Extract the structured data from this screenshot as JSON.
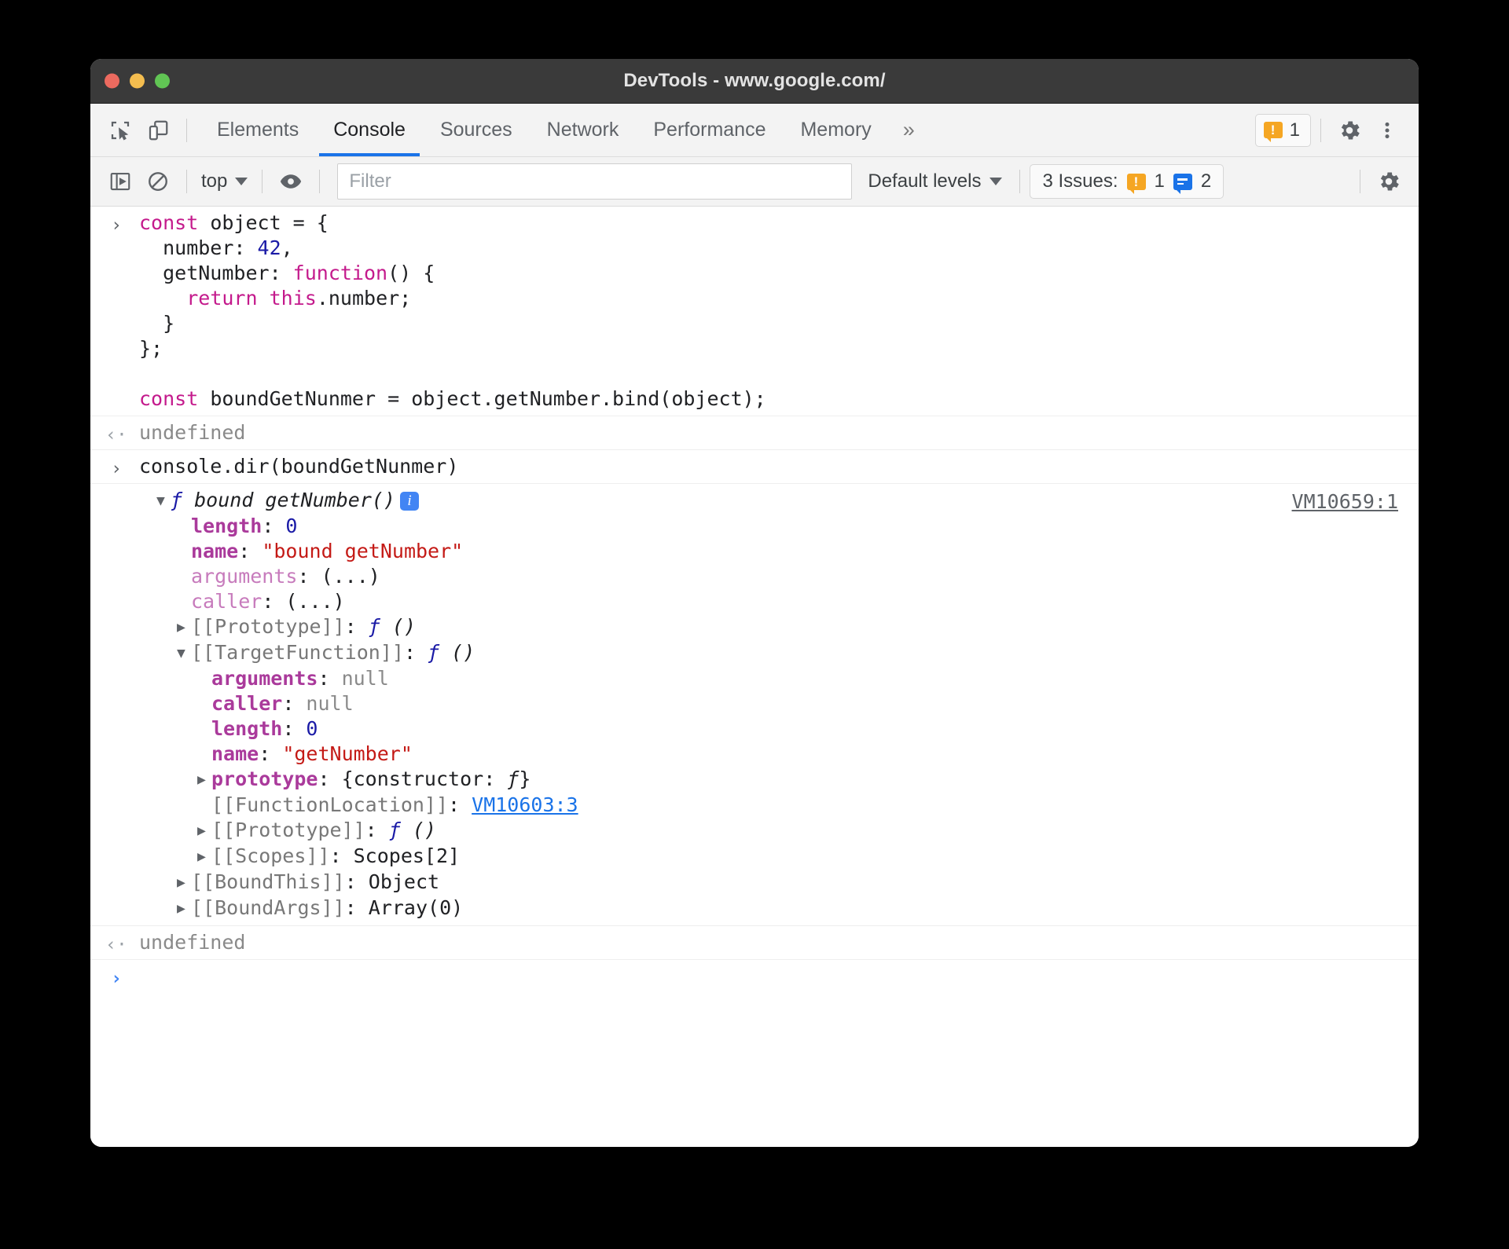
{
  "window": {
    "title": "DevTools - www.google.com/",
    "traffic_lights": [
      "close-red",
      "minimize-yellow",
      "maximize-green"
    ]
  },
  "tabbar": {
    "inspect_icon": "inspect-element-icon",
    "device_icon": "device-toolbar-icon",
    "tabs": [
      {
        "label": "Elements",
        "active": false
      },
      {
        "label": "Console",
        "active": true
      },
      {
        "label": "Sources",
        "active": false
      },
      {
        "label": "Network",
        "active": false
      },
      {
        "label": "Performance",
        "active": false
      },
      {
        "label": "Memory",
        "active": false
      }
    ],
    "more_tabs": "»",
    "warning_chip": {
      "icon": "warning-bubble-icon",
      "count": "1",
      "color": "#f5a623"
    },
    "settings_icon": "gear-icon",
    "more_icon": "vertical-dots-icon"
  },
  "console_toolbar": {
    "sidebar_toggle_icon": "console-sidebar-icon",
    "clear_icon": "clear-console-icon",
    "context": "top",
    "context_caret": "▼",
    "eye_icon": "live-expression-eye-icon",
    "filter_placeholder": "Filter",
    "filter_value": "",
    "levels_label": "Default levels",
    "levels_caret": "▼",
    "issues": {
      "label": "3 Issues:",
      "warning_count": "1",
      "info_count": "2",
      "warning_color": "#f5a623",
      "info_color": "#1a73e8"
    },
    "settings_icon": "gear-icon"
  },
  "console": {
    "input1": {
      "gutter": "›",
      "lines": [
        [
          {
            "t": "const",
            "c": "kw"
          },
          {
            "t": " object = {",
            "c": "plain"
          }
        ],
        [
          {
            "t": "  number: ",
            "c": "plain"
          },
          {
            "t": "42",
            "c": "num"
          },
          {
            "t": ",",
            "c": "plain"
          }
        ],
        [
          {
            "t": "  getNumber: ",
            "c": "plain"
          },
          {
            "t": "function",
            "c": "kw"
          },
          {
            "t": "() {",
            "c": "plain"
          }
        ],
        [
          {
            "t": "    ",
            "c": "plain"
          },
          {
            "t": "return",
            "c": "kw"
          },
          {
            "t": " ",
            "c": "plain"
          },
          {
            "t": "this",
            "c": "kw"
          },
          {
            "t": ".number;",
            "c": "plain"
          }
        ],
        [
          {
            "t": "  }",
            "c": "plain"
          }
        ],
        [
          {
            "t": "};",
            "c": "plain"
          }
        ],
        [
          {
            "t": "",
            "c": "plain"
          }
        ],
        [
          {
            "t": "const",
            "c": "kw"
          },
          {
            "t": " boundGetNunmer = object.getNumber.bind(object);",
            "c": "plain"
          }
        ]
      ]
    },
    "output1": {
      "gutter": "‹·",
      "text": "undefined"
    },
    "input2": {
      "gutter": "›",
      "text": "console.dir(boundGetNunmer)"
    },
    "dir_result": {
      "header": {
        "triangle": "▼",
        "fn_glyph": "ƒ",
        "label": "bound getNumber()",
        "badge": "i",
        "source_link": "VM10659:1"
      },
      "rows": [
        {
          "indent": 2,
          "triangle": "",
          "key": "length",
          "kind": "own",
          "sep": ": ",
          "value": "0",
          "value_class": "num"
        },
        {
          "indent": 2,
          "triangle": "",
          "key": "name",
          "kind": "own",
          "sep": ": ",
          "value": "\"bound getNumber\"",
          "value_class": "str"
        },
        {
          "indent": 2,
          "triangle": "",
          "key": "arguments",
          "kind": "inherited",
          "sep": ": ",
          "value": "(...)",
          "value_class": "plain"
        },
        {
          "indent": 2,
          "triangle": "",
          "key": "caller",
          "kind": "inherited",
          "sep": ": ",
          "value": "(...)",
          "value_class": "plain"
        },
        {
          "indent": 2,
          "triangle": "▶",
          "key": "[[Prototype]]",
          "kind": "internal",
          "sep": ": ",
          "value": "ƒ ()",
          "value_class": "fn"
        },
        {
          "indent": 2,
          "triangle": "▼",
          "key": "[[TargetFunction]]",
          "kind": "internal",
          "sep": ": ",
          "value": "ƒ ()",
          "value_class": "fn"
        },
        {
          "indent": 3,
          "triangle": "",
          "key": "arguments",
          "kind": "own",
          "sep": ": ",
          "value": "null",
          "value_class": "null"
        },
        {
          "indent": 3,
          "triangle": "",
          "key": "caller",
          "kind": "own",
          "sep": ": ",
          "value": "null",
          "value_class": "null"
        },
        {
          "indent": 3,
          "triangle": "",
          "key": "length",
          "kind": "own",
          "sep": ": ",
          "value": "0",
          "value_class": "num"
        },
        {
          "indent": 3,
          "triangle": "",
          "key": "name",
          "kind": "own",
          "sep": ": ",
          "value": "\"getNumber\"",
          "value_class": "str"
        },
        {
          "indent": 3,
          "triangle": "▶",
          "key": "prototype",
          "kind": "own",
          "sep": ": ",
          "value": "{constructor: ƒ}",
          "value_class": "obj"
        },
        {
          "indent": 3,
          "triangle": "",
          "key": "[[FunctionLocation]]",
          "kind": "internal",
          "sep": ": ",
          "value": "VM10603:3",
          "value_class": "link"
        },
        {
          "indent": 3,
          "triangle": "▶",
          "key": "[[Prototype]]",
          "kind": "internal",
          "sep": ": ",
          "value": "ƒ ()",
          "value_class": "fn"
        },
        {
          "indent": 3,
          "triangle": "▶",
          "key": "[[Scopes]]",
          "kind": "internal",
          "sep": ": ",
          "value": "Scopes[2]",
          "value_class": "plain"
        },
        {
          "indent": 2,
          "triangle": "▶",
          "key": "[[BoundThis]]",
          "kind": "internal",
          "sep": ": ",
          "value": "Object",
          "value_class": "plain"
        },
        {
          "indent": 2,
          "triangle": "▶",
          "key": "[[BoundArgs]]",
          "kind": "internal",
          "sep": ": ",
          "value": "Array(0)",
          "value_class": "plain"
        }
      ]
    },
    "output2": {
      "gutter": "‹·",
      "text": "undefined"
    },
    "prompt": {
      "gutter": "›",
      "text": ""
    }
  }
}
